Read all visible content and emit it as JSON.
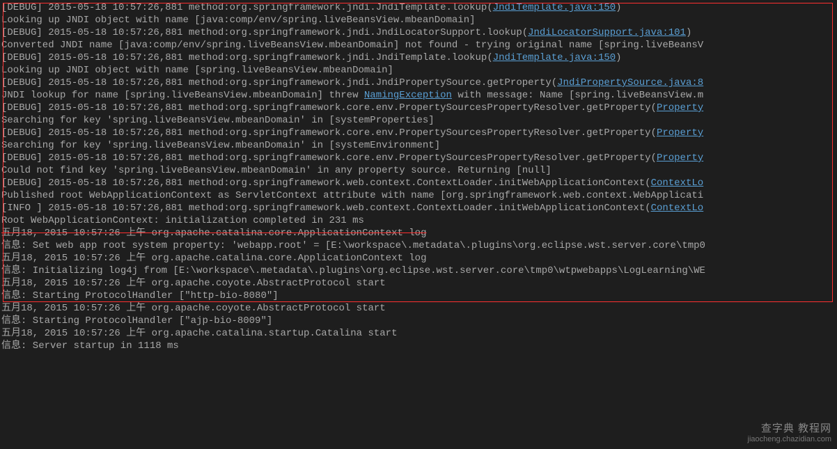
{
  "log": {
    "lines": [
      {
        "segments": [
          {
            "t": "[DEBUG] 2015-05-18 10:57:26,881 method:org.springframework.jndi.JndiTemplate.lookup("
          },
          {
            "t": "JndiTemplate.java:150",
            "link": true
          },
          {
            "t": ")"
          }
        ]
      },
      {
        "segments": [
          {
            "t": "Looking up JNDI object with name [java:comp/env/spring.liveBeansView.mbeanDomain]"
          }
        ]
      },
      {
        "segments": [
          {
            "t": "[DEBUG] 2015-05-18 10:57:26,881 method:org.springframework.jndi.JndiLocatorSupport.lookup("
          },
          {
            "t": "JndiLocatorSupport.java:101",
            "link": true
          },
          {
            "t": ")"
          }
        ]
      },
      {
        "segments": [
          {
            "t": "Converted JNDI name [java:comp/env/spring.liveBeansView.mbeanDomain] not found - trying original name [spring.liveBeansV"
          }
        ]
      },
      {
        "segments": [
          {
            "t": "[DEBUG] 2015-05-18 10:57:26,881 method:org.springframework.jndi.JndiTemplate.lookup("
          },
          {
            "t": "JndiTemplate.java:150",
            "link": true
          },
          {
            "t": ")"
          }
        ]
      },
      {
        "segments": [
          {
            "t": "Looking up JNDI object with name [spring.liveBeansView.mbeanDomain]"
          }
        ]
      },
      {
        "segments": [
          {
            "t": "[DEBUG] 2015-05-18 10:57:26,881 method:org.springframework.jndi.JndiPropertySource.getProperty("
          },
          {
            "t": "JndiPropertySource.java:8",
            "link": true
          }
        ]
      },
      {
        "segments": [
          {
            "t": "JNDI lookup for name [spring.liveBeansView.mbeanDomain] threw "
          },
          {
            "t": "NamingException",
            "link": true
          },
          {
            "t": " with message: Name [spring.liveBeansView.m"
          }
        ]
      },
      {
        "segments": [
          {
            "t": "[DEBUG] 2015-05-18 10:57:26,881 method:org.springframework.core.env.PropertySourcesPropertyResolver.getProperty("
          },
          {
            "t": "Property",
            "link": true
          }
        ]
      },
      {
        "segments": [
          {
            "t": "Searching for key 'spring.liveBeansView.mbeanDomain' in [systemProperties]"
          }
        ]
      },
      {
        "segments": [
          {
            "t": "[DEBUG] 2015-05-18 10:57:26,881 method:org.springframework.core.env.PropertySourcesPropertyResolver.getProperty("
          },
          {
            "t": "Property",
            "link": true
          }
        ]
      },
      {
        "segments": [
          {
            "t": "Searching for key 'spring.liveBeansView.mbeanDomain' in [systemEnvironment]"
          }
        ]
      },
      {
        "segments": [
          {
            "t": "[DEBUG] 2015-05-18 10:57:26,881 method:org.springframework.core.env.PropertySourcesPropertyResolver.getProperty("
          },
          {
            "t": "Property",
            "link": true
          }
        ]
      },
      {
        "segments": [
          {
            "t": "Could not find key 'spring.liveBeansView.mbeanDomain' in any property source. Returning [null]"
          }
        ]
      },
      {
        "segments": [
          {
            "t": "[DEBUG] 2015-05-18 10:57:26,881 method:org.springframework.web.context.ContextLoader.initWebApplicationContext("
          },
          {
            "t": "ContextLo",
            "link": true
          }
        ]
      },
      {
        "segments": [
          {
            "t": "Published root WebApplicationContext as ServletContext attribute with name [org.springframework.web.context.WebApplicati"
          }
        ]
      },
      {
        "segments": [
          {
            "t": "[INFO ] 2015-05-18 10:57:26,881 method:org.springframework.web.context.ContextLoader.initWebApplicationContext("
          },
          {
            "t": "ContextLo",
            "link": true
          }
        ]
      },
      {
        "segments": [
          {
            "t": "Root WebApplicationContext: initialization completed in 231 ms"
          }
        ]
      },
      {
        "segments": [
          {
            "t": "五月18, 2015 10:57:26 上午 org.apache.catalina.core.ApplicationContext log",
            "strike": true
          }
        ]
      },
      {
        "segments": [
          {
            "t": "信息: Set web app root system property: 'webapp.root' = [E:\\workspace\\.metadata\\.plugins\\org.eclipse.wst.server.core\\tmp0"
          }
        ]
      },
      {
        "segments": [
          {
            "t": "五月18, 2015 10:57:26 上午 org.apache.catalina.core.ApplicationContext log"
          }
        ]
      },
      {
        "segments": [
          {
            "t": "信息: Initializing log4j from [E:\\workspace\\.metadata\\.plugins\\org.eclipse.wst.server.core\\tmp0\\wtpwebapps\\LogLearning\\WE"
          }
        ]
      },
      {
        "segments": [
          {
            "t": "五月18, 2015 10:57:26 上午 org.apache.coyote.AbstractProtocol start"
          }
        ]
      },
      {
        "segments": [
          {
            "t": "信息: Starting ProtocolHandler [\"http-bio-8080\"]"
          }
        ]
      },
      {
        "segments": [
          {
            "t": "五月18, 2015 10:57:26 上午 org.apache.coyote.AbstractProtocol start"
          }
        ]
      },
      {
        "segments": [
          {
            "t": "信息: Starting ProtocolHandler [\"ajp-bio-8009\"]"
          }
        ]
      },
      {
        "segments": [
          {
            "t": "五月18, 2015 10:57:26 上午 org.apache.catalina.startup.Catalina start"
          }
        ]
      },
      {
        "segments": [
          {
            "t": "信息: Server startup in 1118 ms"
          }
        ]
      }
    ]
  },
  "watermark": {
    "line1": "查字典 教程网",
    "line2": "jiaocheng.chazidian.com"
  }
}
